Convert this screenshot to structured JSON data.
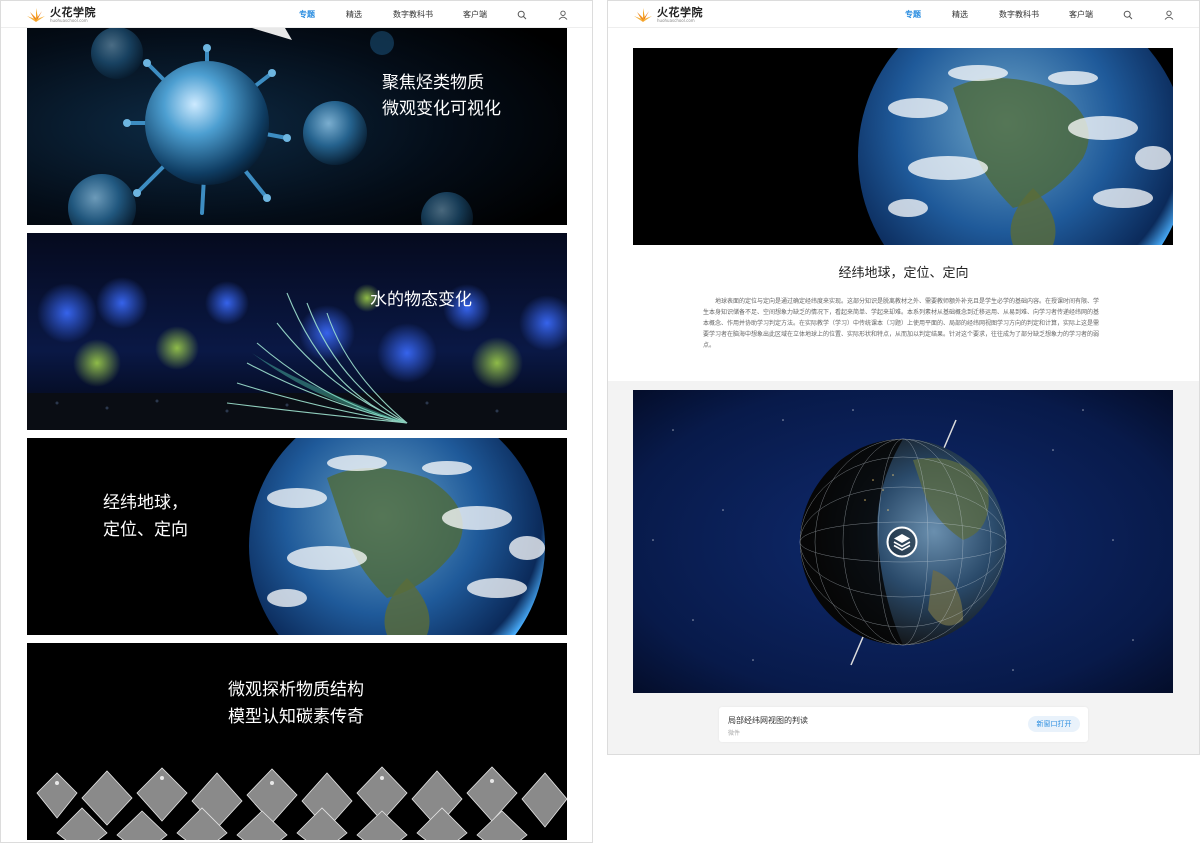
{
  "brand": {
    "name": "火花学院",
    "url": "huohuaschool.com"
  },
  "nav": {
    "items": [
      "专题",
      "精选",
      "数字教科书",
      "客户端"
    ],
    "active_index": 0
  },
  "left": {
    "banners": [
      {
        "title": "聚焦烃类物质\n微观变化可视化"
      },
      {
        "title": "水的物态变化"
      },
      {
        "title": "经纬地球，\n定位、定向"
      },
      {
        "title": "微观探析物质结构\n模型认知碳素传奇"
      }
    ]
  },
  "right": {
    "article_title": "经纬地球，定位、定向",
    "article_body": "地球表面的定位与定向是通过确定经纬度来实现。这部分知识是脱离教材之外、需要教师额外补充且是学生必学的基础内容。在授课时间有限、学生本身知识储备不足、空间想象力缺乏的情况下，看起来简单、学起来却难。本系列素材从基础概念到迁移运用、从易到难、向学习者传递经纬网的基本概念、作用并协助学习判定方法。在实际教学（学习）中传统课本（习题）上使用平面的、局部的经纬网视图学习方向的判定和计算，实际上这是需要学习者在脑海中想象出此区域在立体地球上的位置、实际形状和特点，从而加以判定结果。针对这个要求，往往成为了部分缺乏想象力的学习者的弱点。",
    "resource": {
      "name": "局部经纬网视图的判读",
      "type": "微件",
      "open_label": "新窗口打开"
    }
  }
}
